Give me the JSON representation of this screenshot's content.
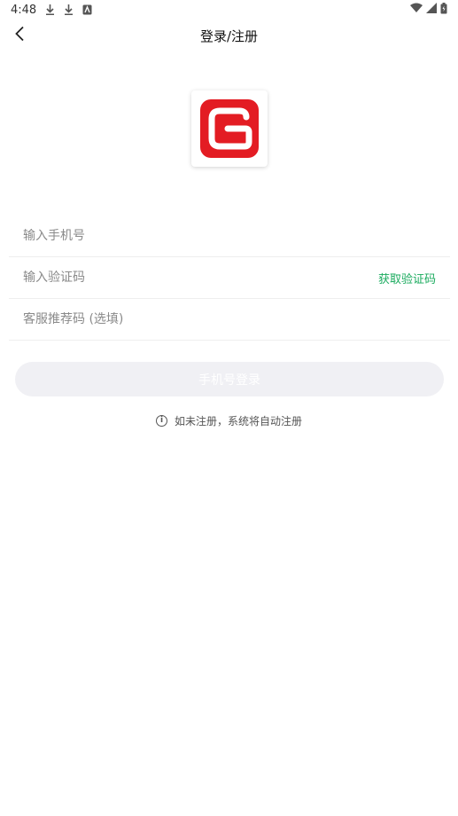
{
  "status_bar": {
    "time": "4:48",
    "icons": [
      "download-icon",
      "download-icon",
      "notification-icon",
      "wifi-icon",
      "signal-icon",
      "battery-icon"
    ]
  },
  "nav": {
    "back_icon": "chevron-left-icon",
    "title": "登录/注册"
  },
  "logo": {
    "color": "#e31c23"
  },
  "form": {
    "phone_placeholder": "输入手机号",
    "code_placeholder": "输入验证码",
    "get_code_label": "获取验证码",
    "referral_placeholder": "客服推荐码 (选填)"
  },
  "login_button_label": "手机号登录",
  "hint": {
    "icon": "info-icon",
    "text": "如未注册，系统将自动注册"
  },
  "colors": {
    "accent_green": "#1aab5e",
    "button_disabled_bg": "#f0f0f4",
    "brand_red": "#e31c23"
  }
}
